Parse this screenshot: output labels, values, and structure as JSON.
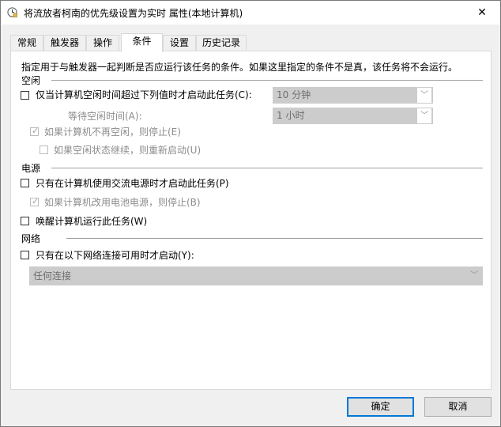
{
  "window": {
    "title": "将流放者柯南的优先级设置为实时 属性(本地计算机)",
    "close_symbol": "✕"
  },
  "tabs": [
    {
      "label": "常规"
    },
    {
      "label": "触发器"
    },
    {
      "label": "操作"
    },
    {
      "label": "条件"
    },
    {
      "label": "设置"
    },
    {
      "label": "历史记录"
    }
  ],
  "active_tab": "条件",
  "conditions": {
    "description": "指定用于与触发器一起判断是否应运行该任务的条件。如果这里指定的条件不是真，该任务将不会运行。",
    "idle": {
      "header": "空闲",
      "start_only_if_idle": {
        "label": "仅当计算机空闲时间超过下列值时才启动此任务(C):",
        "checked": false
      },
      "idle_duration": {
        "value": "10 分钟"
      },
      "wait_label": "等待空闲时间(A):",
      "wait_duration": {
        "value": "1 小时"
      },
      "stop_if_not_idle": {
        "label": "如果计算机不再空闲，则停止(E)",
        "checked": true,
        "enabled": false
      },
      "restart_if_idle_resumes": {
        "label": "如果空闲状态继续，则重新启动(U)",
        "checked": false,
        "enabled": false
      }
    },
    "power": {
      "header": "电源",
      "ac_power_only": {
        "label": "只有在计算机使用交流电源时才启动此任务(P)",
        "checked": false
      },
      "stop_on_battery": {
        "label": "如果计算机改用电池电源，则停止(B)",
        "checked": true,
        "enabled": false
      },
      "wake_to_run": {
        "label": "唤醒计算机运行此任务(W)",
        "checked": false
      }
    },
    "network": {
      "header": "网络",
      "network_available": {
        "label": "只有在以下网络连接可用时才启动(Y):",
        "checked": false
      },
      "connection": {
        "value": "任何连接"
      }
    }
  },
  "buttons": {
    "ok": "确定",
    "cancel": "取消"
  }
}
